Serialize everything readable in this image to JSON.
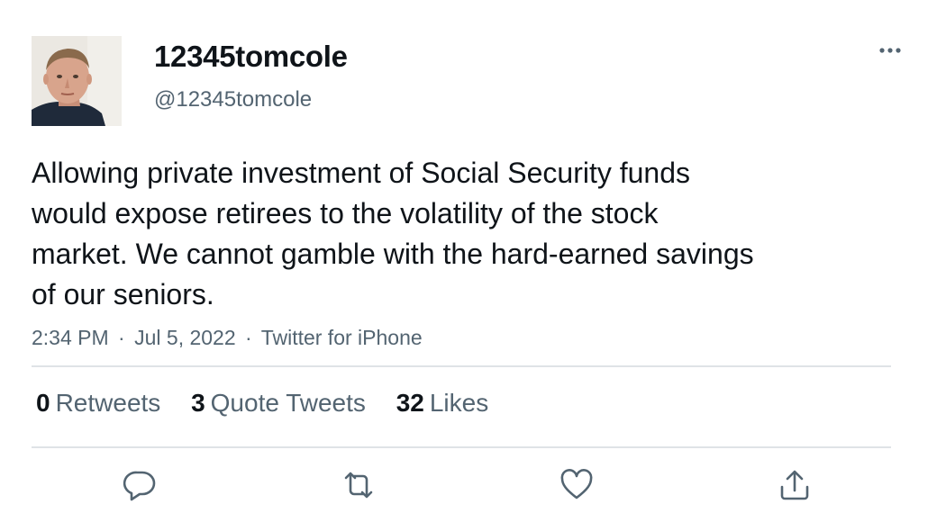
{
  "user": {
    "display_name": "12345tomcole",
    "handle": "@12345tomcole",
    "avatar_icon": "profile-photo"
  },
  "tweet": {
    "lines": [
      "Allowing private investment of Social Security funds",
      "would expose retirees to the volatility of the stock",
      "market. We cannot gamble with the hard-earned savings",
      "of our seniors."
    ],
    "time": "2:34 PM",
    "separator": "·",
    "date": "Jul 5, 2022",
    "source": "Twitter for iPhone"
  },
  "stats": {
    "retweets": {
      "count": "0",
      "label": "Retweets"
    },
    "quotes": {
      "count": "3",
      "label": "Quote Tweets"
    },
    "likes": {
      "count": "32",
      "label": "Likes"
    }
  },
  "actions": [
    {
      "name": "reply",
      "icon": "reply-icon"
    },
    {
      "name": "retweet",
      "icon": "retweet-icon"
    },
    {
      "name": "like",
      "icon": "heart-icon"
    },
    {
      "name": "share",
      "icon": "share-icon"
    }
  ],
  "colors": {
    "text": "#0f1419",
    "secondary": "#536471",
    "divider": "#dfe3e6"
  }
}
